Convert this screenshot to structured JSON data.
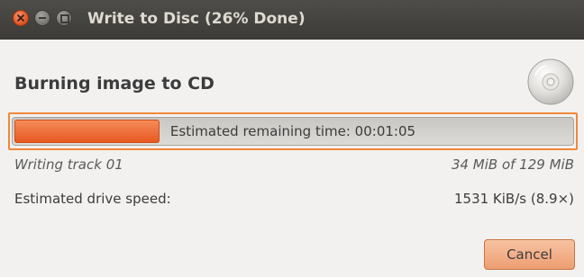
{
  "window": {
    "title": "Write to Disc (26% Done)"
  },
  "main": {
    "heading": "Burning image to CD",
    "disc_icon": "optical-disc-icon"
  },
  "progress": {
    "fraction": 0.26,
    "text": "Estimated remaining time: 00:01:05",
    "fill_color": "#e7571f"
  },
  "details": {
    "track_label": "Writing track 01",
    "track_size": "34 MiB of 129 MiB",
    "speed_label": "Estimated drive speed:",
    "speed_value": "1531 KiB/s (8.9×)"
  },
  "actions": {
    "cancel_label": "Cancel"
  },
  "colors": {
    "titlebar": "#3c3b37",
    "accent": "#f0883a",
    "close_button": "#e0501f"
  }
}
